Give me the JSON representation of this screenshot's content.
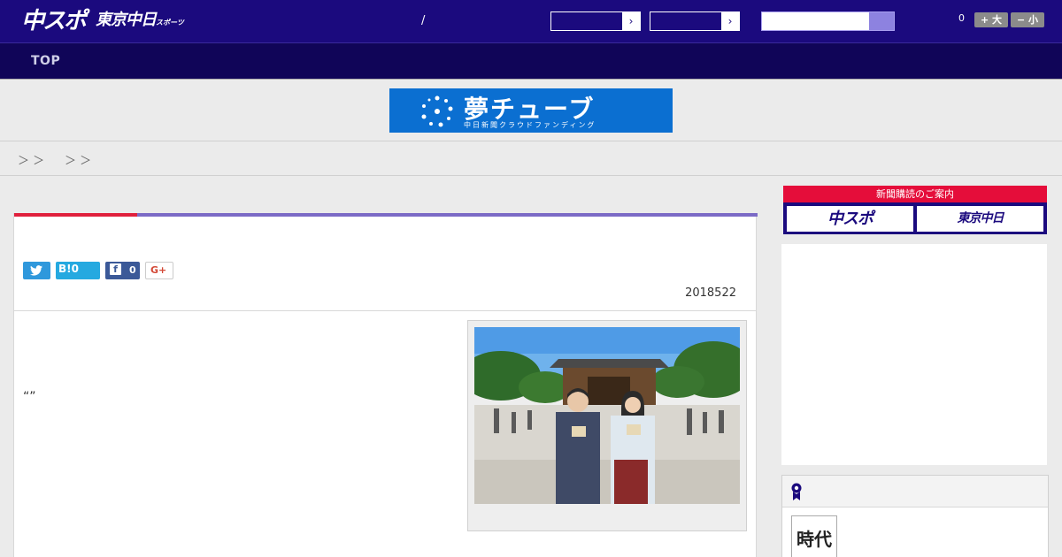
{
  "header": {
    "logo_main": "中スポ",
    "logo_sub": "東京中日",
    "logo_sub_small": "スポーツ",
    "separator": "/",
    "font_size_count": "0",
    "font_larger_label": "+ 大",
    "font_smaller_label": "− 小",
    "select_arrow": "›"
  },
  "nav": {
    "top_label": "TOP"
  },
  "banner": {
    "title": "夢チューブ",
    "subtitle": "中日新聞クラウドファンディング"
  },
  "breadcrumb": {
    "sep1": "＞ ＞",
    "sep2": "＞ ＞"
  },
  "article": {
    "share_hatena": "B!0",
    "share_facebook_count": "0",
    "share_gplus": "G+",
    "date": "2018522",
    "quote": "“”"
  },
  "sidebar": {
    "subscribe_title": "新聞購読のご案内",
    "subscribe_chuspo": "中スポ",
    "subscribe_tokyo": "東京中日",
    "ranking_thumb_text": "時代"
  },
  "colors": {
    "header_bg": "#1b0a7e",
    "nav_bg": "#100558",
    "accent_red": "#e0203c",
    "accent_purple": "#7b6ac6",
    "twitter": "#2f98dc",
    "facebook": "#3b5998"
  }
}
